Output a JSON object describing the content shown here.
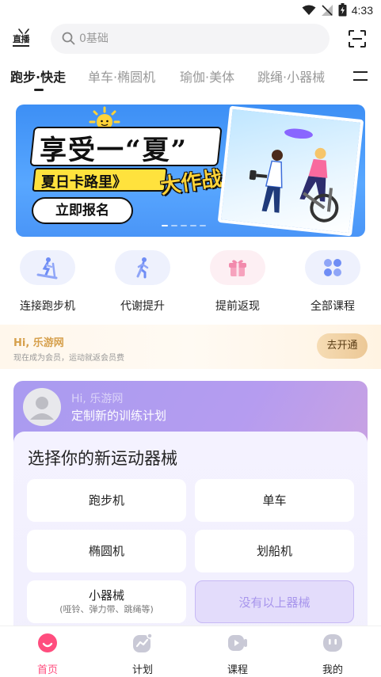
{
  "status_bar": {
    "time": "4:33"
  },
  "top_bar": {
    "live_label": "直播",
    "search_placeholder": "0基础"
  },
  "tabs": [
    {
      "label": "跑步·快走",
      "active": true
    },
    {
      "label": "单车·椭圆机",
      "active": false
    },
    {
      "label": "瑜伽·美体",
      "active": false
    },
    {
      "label": "跳绳·小器械",
      "active": false
    }
  ],
  "banner": {
    "title": "享受一“夏”",
    "subtitle": "夏日卡路里》",
    "accent": "大作战",
    "cta": "立即报名"
  },
  "quick_actions": [
    {
      "label": "连接跑步机",
      "icon": "treadmill-icon"
    },
    {
      "label": "代谢提升",
      "icon": "walking-person-icon"
    },
    {
      "label": "提前返现",
      "icon": "gift-icon"
    },
    {
      "label": "全部课程",
      "icon": "grid-icon"
    }
  ],
  "membership": {
    "title": "Hi, 乐游网",
    "desc": "现在成为会员，运动就返会员费",
    "button": "去开通"
  },
  "plan": {
    "greeting": "Hi, 乐游网",
    "title": "定制新的训练计划",
    "question": "选择你的新运动器械",
    "options": [
      {
        "label": "跑步机"
      },
      {
        "label": "单车"
      },
      {
        "label": "椭圆机"
      },
      {
        "label": "划船机"
      },
      {
        "label": "小器械",
        "sub": "(哑铃、弹力带、跳绳等)"
      },
      {
        "label": "没有以上器械"
      }
    ]
  },
  "bottom_nav": [
    {
      "label": "首页",
      "active": true,
      "icon": "home-icon"
    },
    {
      "label": "计划",
      "active": false,
      "icon": "plan-icon"
    },
    {
      "label": "课程",
      "active": false,
      "icon": "course-icon"
    },
    {
      "label": "我的",
      "active": false,
      "icon": "profile-icon"
    }
  ],
  "colors": {
    "accent_pink": "#ff4d7e",
    "plan_purple": "#a99bf0",
    "banner_blue": "#3d8ff5",
    "gold": "#d6a04c"
  }
}
